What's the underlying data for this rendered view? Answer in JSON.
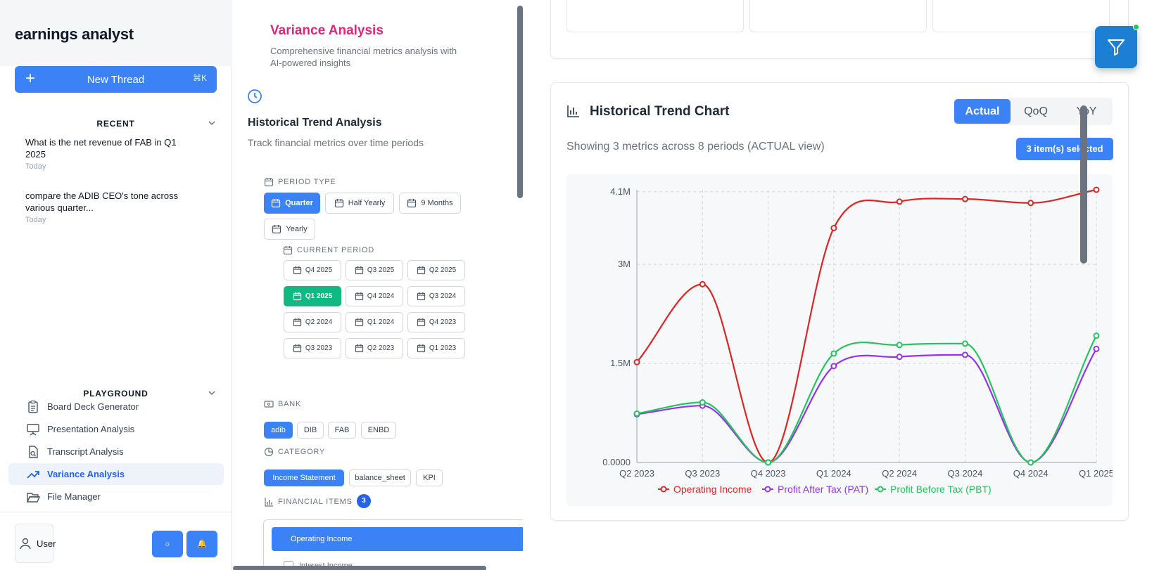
{
  "sidebar": {
    "brand": "earnings analyst",
    "new_thread": {
      "label": "New Thread",
      "shortcut": "⌘K"
    },
    "recent": {
      "heading": "RECENT",
      "threads": [
        {
          "title": "What is the net revenue of FAB in Q1 2025",
          "date": "Today"
        },
        {
          "title": "compare the ADIB CEO's tone across various quarter...",
          "date": "Today"
        }
      ]
    },
    "playground": {
      "heading": "PLAYGROUND",
      "items": [
        {
          "label": "Board Deck Generator",
          "icon": "clipboard-icon"
        },
        {
          "label": "Presentation Analysis",
          "icon": "presentation-icon"
        },
        {
          "label": "Transcript Analysis",
          "icon": "file-search-icon"
        },
        {
          "label": "Variance Analysis",
          "icon": "trending-up-icon",
          "active": true
        },
        {
          "label": "File Manager",
          "icon": "folder-open-icon"
        }
      ]
    },
    "footer": {
      "user_label": "User",
      "btn1": "☼",
      "btn2": "🔔"
    }
  },
  "middle": {
    "title": "Variance Analysis",
    "subtitle": "Comprehensive financial metrics analysis with AI-powered insights",
    "section_title": "Historical Trend Analysis",
    "section_subtitle": "Track financial metrics over time periods",
    "period_type": {
      "label": "PERIOD TYPE",
      "options": [
        "Quarter",
        "Half Yearly",
        "9 Months",
        "Yearly"
      ],
      "selected": "Quarter"
    },
    "current_period": {
      "label": "CURRENT PERIOD",
      "options": [
        "Q4 2025",
        "Q3 2025",
        "Q2 2025",
        "Q1 2025",
        "Q4 2024",
        "Q3 2024",
        "Q2 2024",
        "Q1 2024",
        "Q4 2023",
        "Q3 2023",
        "Q2 2023",
        "Q1 2023"
      ],
      "selected": "Q1 2025"
    },
    "bank": {
      "label": "BANK",
      "options": [
        "adib",
        "DIB",
        "FAB",
        "ENBD"
      ],
      "selected": "adib"
    },
    "category": {
      "label": "CATEGORY",
      "options": [
        "Income Statement",
        "balance_sheet",
        "KPI"
      ],
      "selected": "Income Statement"
    },
    "financial_items": {
      "label": "FINANCIAL ITEMS",
      "count": "3",
      "items": [
        "Operating Income",
        "Interest Income"
      ]
    }
  },
  "right": {
    "chart_title": "Historical Trend Chart",
    "view_toggle": {
      "options": [
        "Actual",
        "QoQ",
        "YoY"
      ],
      "selected": "Actual"
    },
    "info_text": "Showing 3 metrics across 8 periods (ACTUAL view)",
    "selected_badge": "3 item(s) selected"
  },
  "chart_data": {
    "type": "line",
    "x": [
      "Q2 2023",
      "Q3 2023",
      "Q4 2023",
      "Q1 2024",
      "Q2 2024",
      "Q3 2024",
      "Q4 2024",
      "Q1 2025"
    ],
    "series": [
      {
        "name": "Operating Income",
        "color": "#dc2626",
        "values": [
          1520000,
          2700000,
          0,
          3550000,
          3950000,
          3990000,
          3930000,
          4130000
        ]
      },
      {
        "name": "Profit After Tax (PAT)",
        "color": "#9333ea",
        "values": [
          730000,
          860000,
          0,
          1460000,
          1600000,
          1630000,
          0,
          1720000
        ]
      },
      {
        "name": "Profit Before Tax (PBT)",
        "color": "#22c55e",
        "values": [
          740000,
          910000,
          0,
          1650000,
          1780000,
          1800000,
          0,
          1920000
        ]
      }
    ],
    "y_ticks": [
      {
        "value": 0,
        "label": "0.0000"
      },
      {
        "value": 1500000,
        "label": "1.5M"
      },
      {
        "value": 3000000,
        "label": "3M"
      },
      {
        "value": 4100000,
        "label": "4.1M"
      }
    ],
    "ylim": [
      0,
      4130000
    ],
    "grid": true,
    "legend": "bottom"
  }
}
